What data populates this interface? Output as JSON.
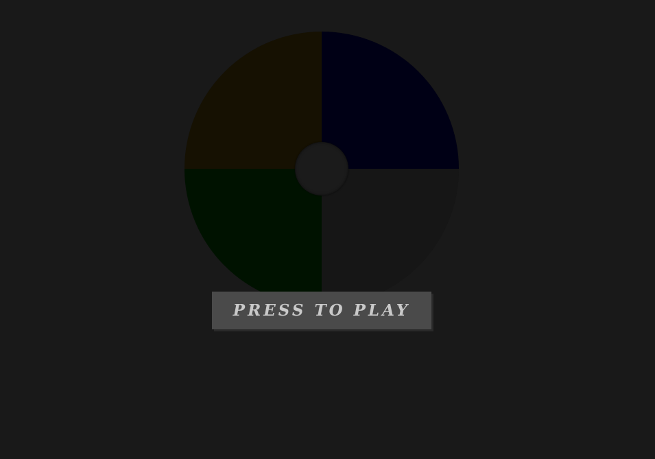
{
  "game": {
    "title_button_label": "PRESS TO PLAY"
  },
  "pads": [
    {
      "name": "yellow",
      "color": "#161102"
    },
    {
      "name": "blue",
      "color": "#000015"
    },
    {
      "name": "green",
      "color": "#001200"
    },
    {
      "name": "red",
      "color": "#161616"
    }
  ],
  "colors": {
    "background": "#191919",
    "button": "#4a4a4a",
    "button_text": "#c9c9c9",
    "hub": "#1b1b1b"
  }
}
